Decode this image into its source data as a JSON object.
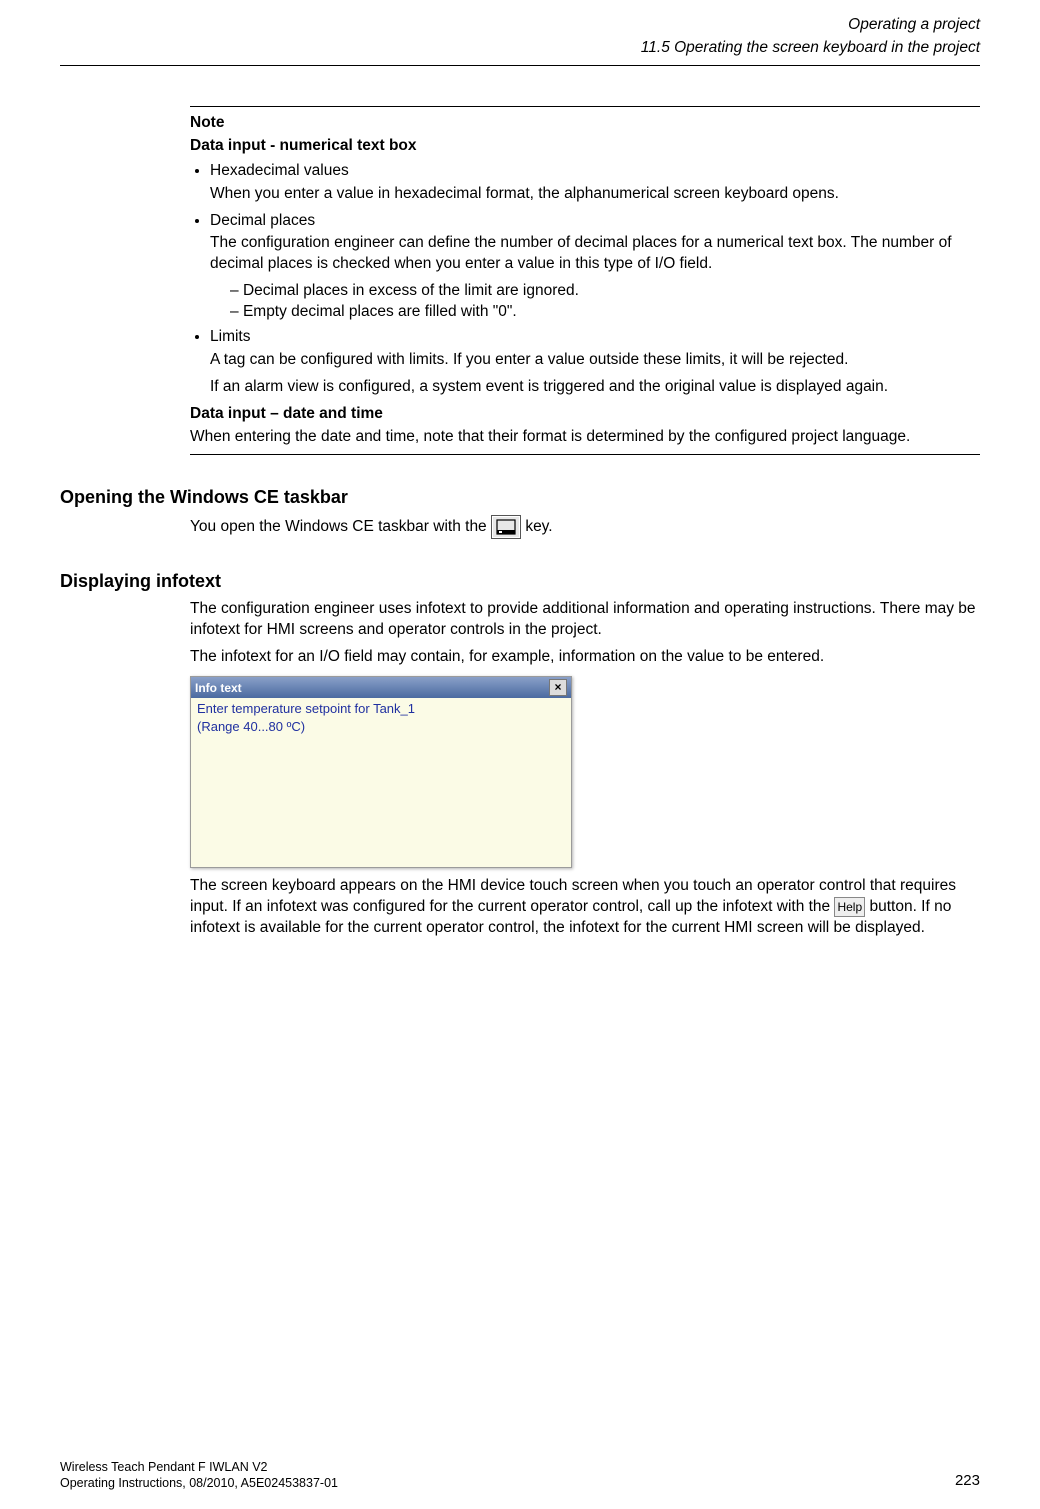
{
  "header": {
    "chapter": "Operating a project",
    "section": "11.5 Operating the screen keyboard in the project"
  },
  "note": {
    "label": "Note",
    "sub1_title": "Data input - numerical text box",
    "bul1_title": "Hexadecimal values",
    "bul1_text": "When you enter a value in hexadecimal format, the alphanumerical screen keyboard opens.",
    "bul2_title": "Decimal places",
    "bul2_text": "The configuration engineer can define the number of decimal places for a numerical text box. The number of decimal places is checked when you enter a value in this type of I/O field.",
    "bul2_d1": "Decimal places in excess of the limit are ignored.",
    "bul2_d2": "Empty decimal places are filled with \"0\".",
    "bul3_title": "Limits",
    "bul3_text1": "A tag can be configured with limits. If you enter a value outside these limits, it will be rejected.",
    "bul3_text2": "If an alarm view is configured, a system event is triggered and the original value is displayed again.",
    "sub2_title": "Data input – date and time",
    "sub2_text": "When entering the date and time, note that their format is determined by the configured project language."
  },
  "sec_open": {
    "heading": "Opening the Windows CE taskbar",
    "text_pre": "You open the Windows CE taskbar with the ",
    "text_post": " key."
  },
  "sec_info": {
    "heading": "Displaying infotext",
    "p1": "The configuration engineer uses infotext to provide additional information and operating instructions. There may be infotext for HMI screens and operator controls in the project.",
    "p2": "The infotext for an I/O field may contain, for example, information on the value to be entered.",
    "window_title": "Info text",
    "window_body": "Enter temperature setpoint for Tank_1\n (Range 40...80 ºC)",
    "p3_pre": "The screen keyboard appears on the HMI device touch screen when you touch an operator control that requires input. If an infotext was configured for the current operator control, call up the infotext with the ",
    "help_label": "Help",
    "p3_post": " button. If no infotext is available for the current operator control, the infotext for the current HMI screen will be displayed."
  },
  "footer": {
    "line1": "Wireless Teach Pendant F IWLAN V2",
    "line2": "Operating Instructions, 08/2010, A5E02453837-01",
    "pageno": "223"
  }
}
